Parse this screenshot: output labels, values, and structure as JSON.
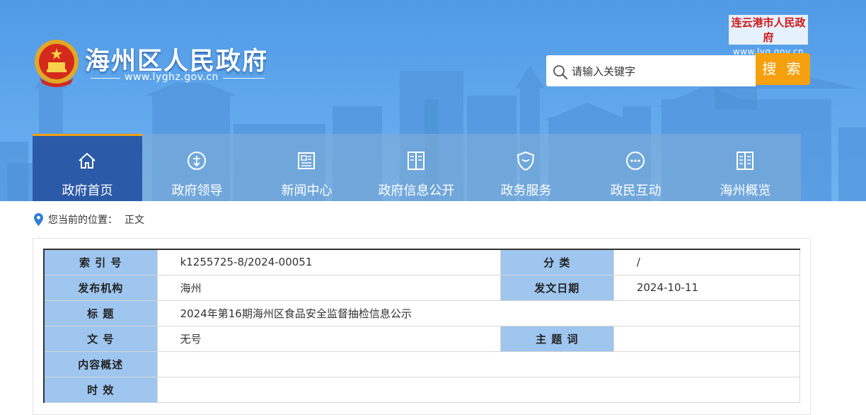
{
  "header": {
    "site_title": "海州区人民政府",
    "site_url": "www.lyghz.gov.cn",
    "city_name": "连云港市人民政府",
    "city_url": "www.lyg.gov.cn",
    "search_placeholder": "请输入关键字",
    "search_button": "搜 索"
  },
  "nav": {
    "items": [
      {
        "label": "政府首页",
        "icon": "home-icon",
        "active": true
      },
      {
        "label": "政府领导",
        "icon": "leader-icon",
        "active": false
      },
      {
        "label": "新闻中心",
        "icon": "news-icon",
        "active": false
      },
      {
        "label": "政府信息公开",
        "icon": "document-icon",
        "active": false
      },
      {
        "label": "政务服务",
        "icon": "shield-icon",
        "active": false
      },
      {
        "label": "政民互动",
        "icon": "chat-icon",
        "active": false
      },
      {
        "label": "海州概览",
        "icon": "book-icon",
        "active": false
      }
    ]
  },
  "breadcrumb": {
    "label": "您当前的位置：",
    "current": "正文"
  },
  "meta": {
    "index_label": "索 引 号",
    "index_value": "k1255725-8/2024-00051",
    "category_label": "分 类",
    "category_value": "/",
    "org_label": "发布机构",
    "org_value": "海州",
    "date_label": "发文日期",
    "date_value": "2024-10-11",
    "title_label": "标 题",
    "title_value": "2024年第16期海州区食品安全监督抽检信息公示",
    "docno_label": "文 号",
    "docno_value": "无号",
    "subject_label": "主 题 词",
    "subject_value": "",
    "summary_label": "内容概述",
    "summary_value": "",
    "validity_label": "时 效",
    "validity_value": ""
  },
  "colors": {
    "header_bg": "#5ea6ec",
    "nav_active": "#2b5aa8",
    "accent_orange": "#f5a00f",
    "table_key_bg": "#9ec6ef",
    "city_red": "#d01818"
  }
}
